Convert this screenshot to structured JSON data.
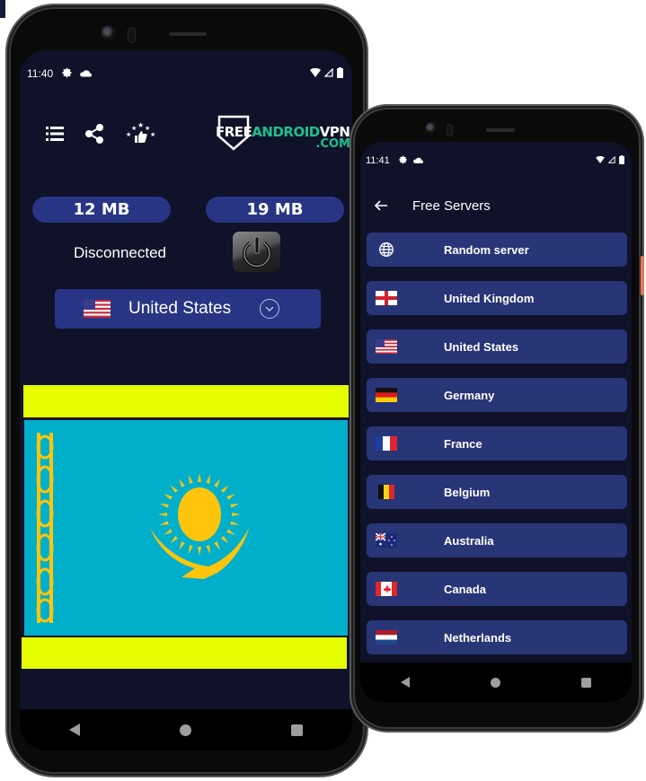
{
  "phone_main": {
    "status_bar": {
      "time": "11:40",
      "icons": [
        "gear-icon",
        "cloud-icon",
        "wifi-icon",
        "signal-icon",
        "battery-icon"
      ]
    },
    "toolbar": {
      "buttons": [
        "menu-list-icon",
        "share-icon",
        "rate-thumbs-up-icon"
      ]
    },
    "logo": {
      "free": "FREE",
      "android": "ANDROID",
      "vpn": "VPN",
      "com": ".COM"
    },
    "stats": {
      "download": "12 MB",
      "upload": "19 MB"
    },
    "connection_status": "Disconnected",
    "selected_country": {
      "label": "United States",
      "flag": "us"
    },
    "ad_banner": {
      "flag": "kazakhstan",
      "stripe_color": "#e5ff00",
      "flag_color": "#00afca",
      "emblem_color": "#fec50c"
    },
    "nav": [
      "back",
      "home",
      "recents"
    ]
  },
  "phone_servers": {
    "status_bar": {
      "time": "11:41",
      "icons": [
        "gear-icon",
        "cloud-icon",
        "wifi-icon",
        "signal-icon",
        "battery-icon"
      ]
    },
    "header": {
      "title": "Free Servers"
    },
    "servers": [
      {
        "name": "Random server",
        "flag": "globe"
      },
      {
        "name": "United Kingdom",
        "flag": "gb"
      },
      {
        "name": "United States",
        "flag": "us"
      },
      {
        "name": "Germany",
        "flag": "de"
      },
      {
        "name": "France",
        "flag": "fr"
      },
      {
        "name": "Belgium",
        "flag": "be"
      },
      {
        "name": "Australia",
        "flag": "au"
      },
      {
        "name": "Canada",
        "flag": "ca"
      },
      {
        "name": "Netherlands",
        "flag": "nl"
      }
    ],
    "nav": [
      "back",
      "home",
      "recents"
    ]
  },
  "colors": {
    "background": "#10122a",
    "card": "#283584",
    "accent_green": "#1fbf8f"
  }
}
